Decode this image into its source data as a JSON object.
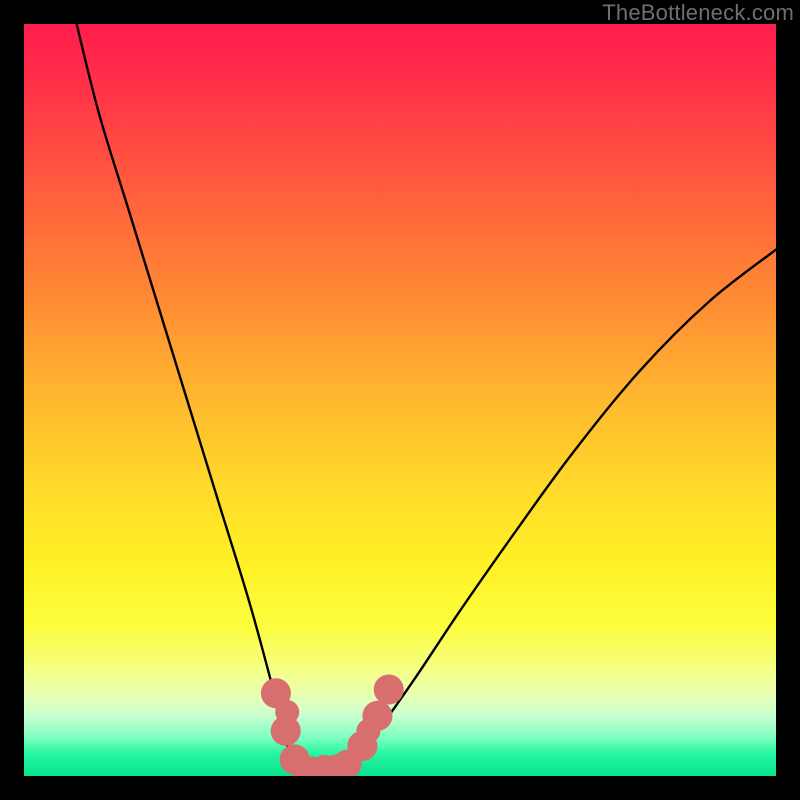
{
  "watermark": "TheBottleneck.com",
  "chart_data": {
    "type": "line",
    "title": "",
    "xlabel": "",
    "ylabel": "",
    "xlim": [
      0,
      100
    ],
    "ylim": [
      0,
      100
    ],
    "grid": false,
    "gradient_stops": [
      {
        "pct": 0,
        "color": "#ff1d4c"
      },
      {
        "pct": 14,
        "color": "#ff4444"
      },
      {
        "pct": 38,
        "color": "#ff8f33"
      },
      {
        "pct": 62,
        "color": "#ffdb2a"
      },
      {
        "pct": 85,
        "color": "#f7ff79"
      },
      {
        "pct": 95,
        "color": "#7affc0"
      },
      {
        "pct": 100,
        "color": "#07e38e"
      }
    ],
    "series": [
      {
        "name": "bottleneck-curve",
        "x": [
          7,
          10,
          14,
          18,
          22,
          26,
          30,
          33,
          34.5,
          36,
          38,
          40.5,
          43,
          47,
          52,
          58,
          65,
          73,
          82,
          91,
          100
        ],
        "y": [
          100,
          88,
          75,
          62,
          49,
          36,
          23,
          12,
          6,
          1.5,
          0.8,
          0.8,
          1.5,
          6,
          13,
          22,
          32,
          43,
          54,
          63,
          70
        ]
      }
    ],
    "markers": {
      "name": "highlight-dots",
      "color": "#d76f6f",
      "points": [
        {
          "x": 33.5,
          "y": 11,
          "r": 2.0
        },
        {
          "x": 34.8,
          "y": 6,
          "r": 2.0
        },
        {
          "x": 35.0,
          "y": 8.5,
          "r": 1.6
        },
        {
          "x": 36.0,
          "y": 2.2,
          "r": 2.0
        },
        {
          "x": 37.0,
          "y": 1.2,
          "r": 1.7
        },
        {
          "x": 38.2,
          "y": 0.9,
          "r": 1.7
        },
        {
          "x": 40.0,
          "y": 0.8,
          "r": 2.0
        },
        {
          "x": 41.7,
          "y": 1.0,
          "r": 1.9
        },
        {
          "x": 43.0,
          "y": 1.6,
          "r": 1.9
        },
        {
          "x": 45.0,
          "y": 4.0,
          "r": 2.0
        },
        {
          "x": 45.8,
          "y": 6.0,
          "r": 1.6
        },
        {
          "x": 47.0,
          "y": 8.0,
          "r": 2.0
        },
        {
          "x": 48.5,
          "y": 11.5,
          "r": 2.0
        }
      ]
    }
  }
}
